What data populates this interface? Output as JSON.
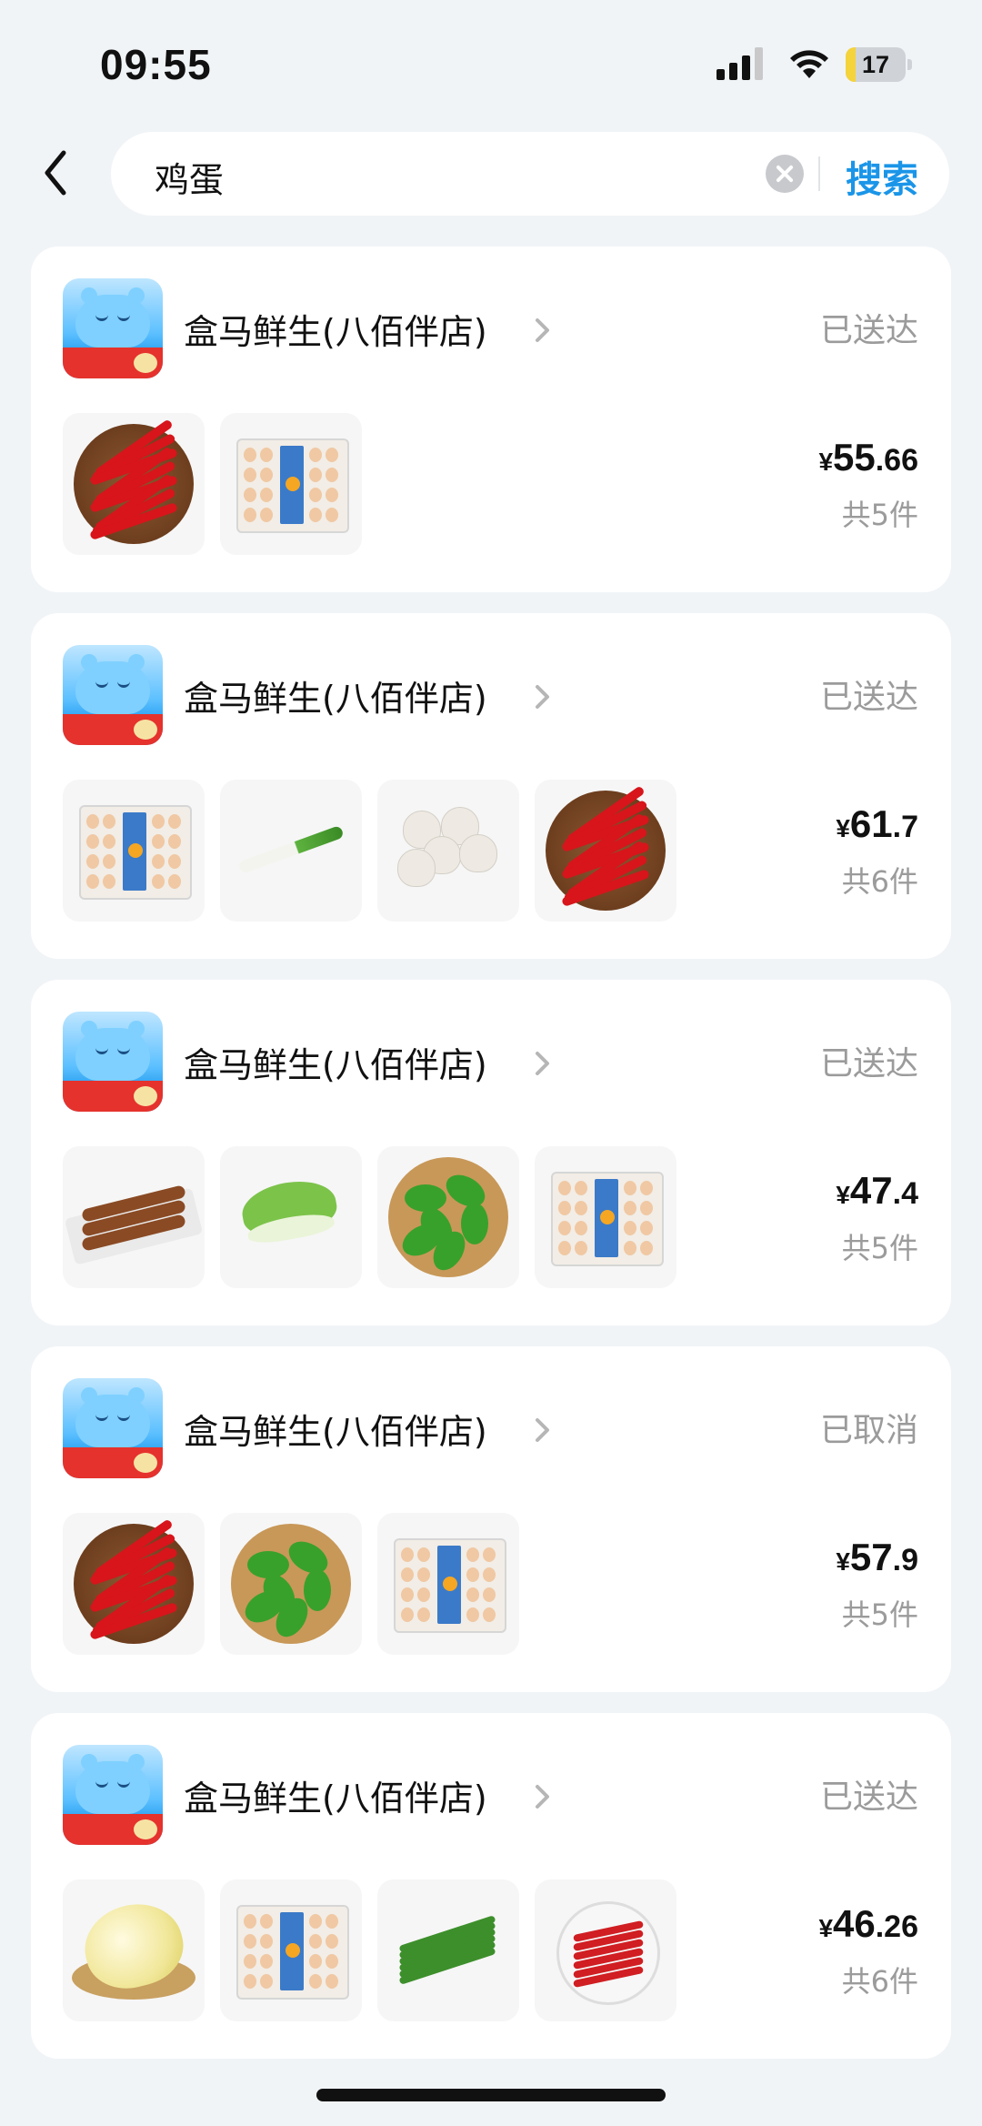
{
  "status_bar": {
    "time": "09:55",
    "battery": "17",
    "battery_level": 0.17
  },
  "search": {
    "query": "鸡蛋",
    "button": "搜索"
  },
  "orders": [
    {
      "store": "盒马鲜生(八佰伴店)",
      "status": "已送达",
      "currency": "¥",
      "price_int": "55",
      "price_dec": ".66",
      "count": "共5件",
      "items": [
        "red-chili",
        "egg-tray"
      ]
    },
    {
      "store": "盒马鲜生(八佰伴店)",
      "status": "已送达",
      "currency": "¥",
      "price_int": "61",
      "price_dec": ".7",
      "count": "共6件",
      "items": [
        "egg-tray",
        "leek",
        "garlic",
        "red-chili"
      ]
    },
    {
      "store": "盒马鲜生(八佰伴店)",
      "status": "已送达",
      "currency": "¥",
      "price_int": "47",
      "price_dec": ".4",
      "count": "共5件",
      "items": [
        "meat-sticks",
        "bok-choy",
        "green-pepper",
        "egg-tray"
      ]
    },
    {
      "store": "盒马鲜生(八佰伴店)",
      "status": "已取消",
      "currency": "¥",
      "price_int": "57",
      "price_dec": ".9",
      "count": "共5件",
      "items": [
        "red-chili",
        "green-pepper",
        "egg-tray"
      ]
    },
    {
      "store": "盒马鲜生(八佰伴店)",
      "status": "已送达",
      "currency": "¥",
      "price_int": "46",
      "price_dec": ".26",
      "count": "共6件",
      "items": [
        "napa-cabbage",
        "egg-tray",
        "green-beans",
        "red-chili-plate"
      ]
    }
  ],
  "colors": {
    "accent": "#1a95e8",
    "background": "#f1f4f7",
    "muted_text": "#9b9b9b",
    "logo_red": "#e5322d"
  }
}
